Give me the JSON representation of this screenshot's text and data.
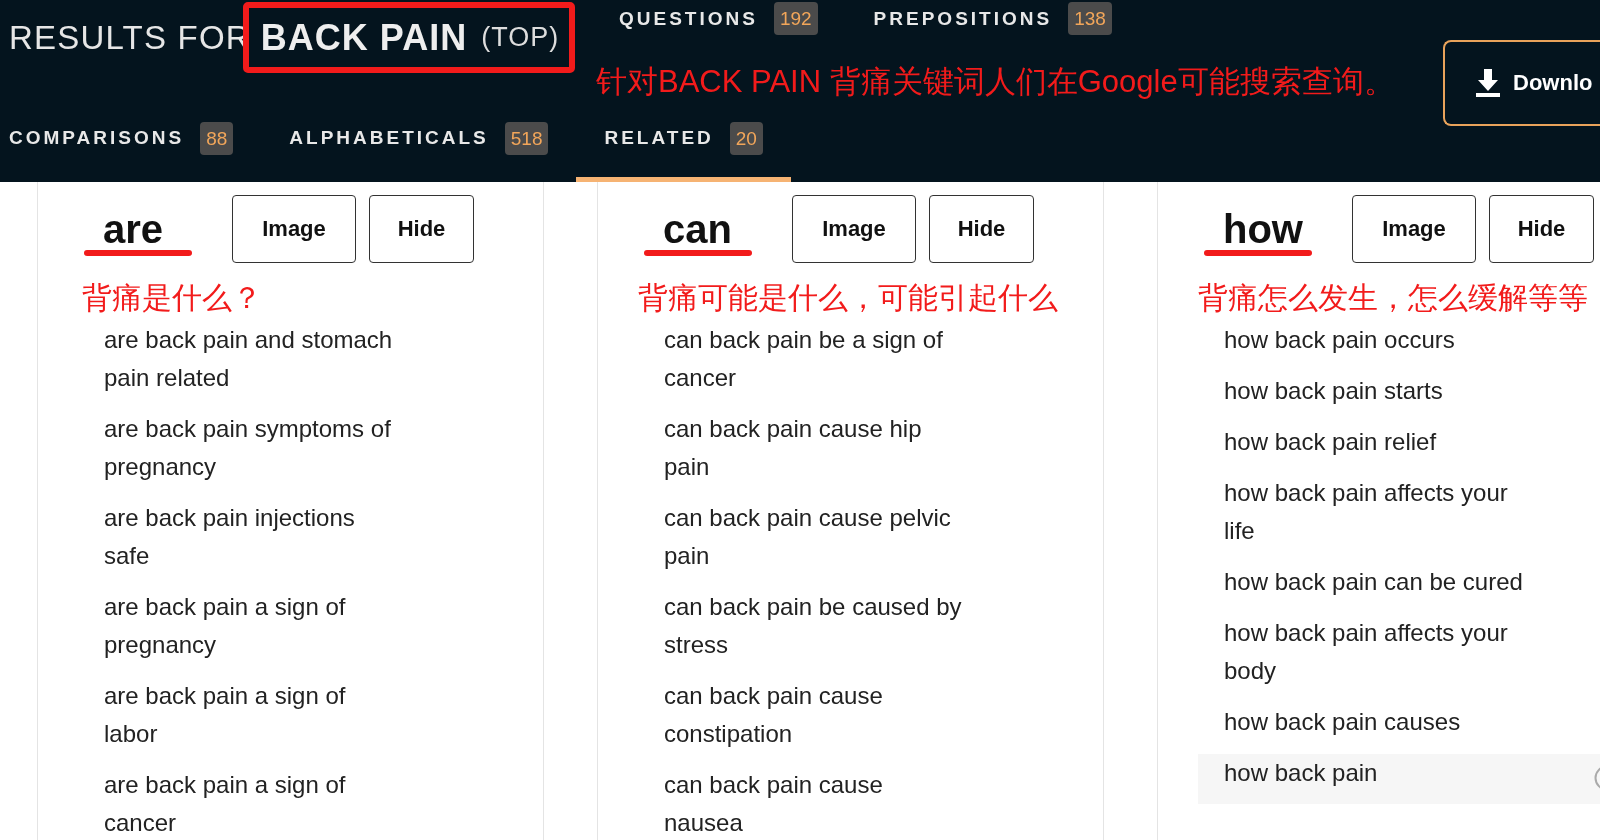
{
  "header": {
    "title_prefix": "RESULTS FOR",
    "query": "BACK PAIN",
    "scope": "(TOP)",
    "query_marked": true,
    "tab_rows": [
      {
        "tabs": [
          {
            "label": "QUESTIONS",
            "count": "192",
            "selected": false
          },
          {
            "label": "PREPOSITIONS",
            "count": "138",
            "selected": false
          }
        ]
      },
      {
        "tabs": [
          {
            "label": "COMPARISONS",
            "count": "88",
            "selected": false
          },
          {
            "label": "ALPHABETICALS",
            "count": "518",
            "selected": false
          },
          {
            "label": "RELATED",
            "count": "20",
            "selected": true
          }
        ]
      }
    ],
    "download_button": {
      "label": "Downlo"
    },
    "annotation": "针对BACK PAIN 背痛关键词人们在Google可能搜索查询。"
  },
  "columns": [
    {
      "word": "are",
      "underlined": true,
      "buttons": [
        "Image",
        "Hide"
      ],
      "annotation": "背痛是什么？",
      "items": [
        {
          "text": "are back pain and stomach pain related",
          "hovered": false
        },
        {
          "text": "are back pain symptoms of pregnancy",
          "hovered": false
        },
        {
          "text": "are back pain injections safe",
          "hovered": false
        },
        {
          "text": "are back pain a sign of pregnancy",
          "hovered": false
        },
        {
          "text": "are back pain a sign of labor",
          "hovered": false
        },
        {
          "text": "are back pain a sign of cancer",
          "hovered": false
        }
      ]
    },
    {
      "word": "can",
      "underlined": true,
      "buttons": [
        "Image",
        "Hide"
      ],
      "annotation": "背痛可能是什么，可能引起什么",
      "items": [
        {
          "text": "can back pain be a sign of cancer",
          "hovered": false
        },
        {
          "text": "can back pain cause hip pain",
          "hovered": false
        },
        {
          "text": "can back pain cause pelvic pain",
          "hovered": false
        },
        {
          "text": "can back pain be caused by stress",
          "hovered": false
        },
        {
          "text": "can back pain cause constipation",
          "hovered": false
        },
        {
          "text": "can back pain cause nausea",
          "hovered": false
        }
      ]
    },
    {
      "word": "how",
      "underlined": true,
      "buttons": [
        "Image",
        "Hide"
      ],
      "annotation": "背痛怎么发生，怎么缓解等等",
      "items": [
        {
          "text": "how back pain occurs",
          "hovered": false
        },
        {
          "text": "how back pain starts",
          "hovered": false
        },
        {
          "text": "how back pain relief",
          "hovered": false
        },
        {
          "text": "how back pain affects your life",
          "hovered": false
        },
        {
          "text": "how back pain can be cured",
          "hovered": false
        },
        {
          "text": "how back pain affects your body",
          "hovered": false
        },
        {
          "text": "how back pain causes",
          "hovered": false
        },
        {
          "text": "how back pain",
          "hovered": true
        }
      ]
    }
  ]
}
